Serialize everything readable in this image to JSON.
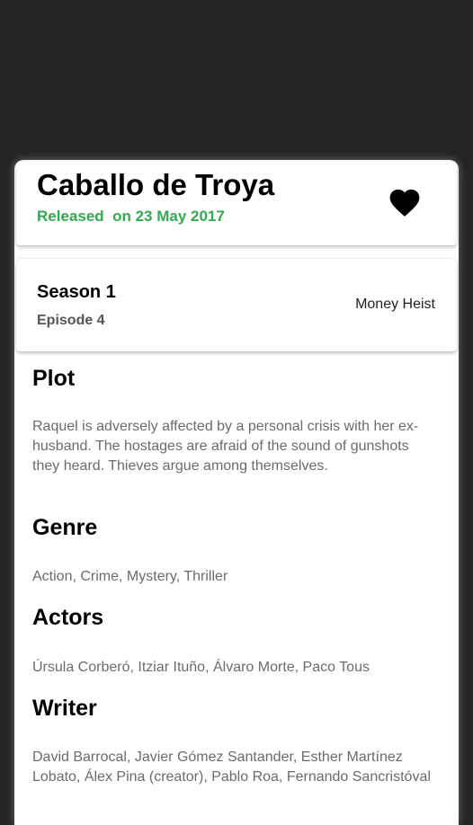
{
  "episode": {
    "title": "Caballo de Troya",
    "released": "Released  on 23 May 2017",
    "favorite_icon": "heart-icon"
  },
  "season_card": {
    "season": "Season 1",
    "episode": "Episode 4",
    "series": "Money Heist"
  },
  "sections": {
    "plot": {
      "heading": "Plot",
      "body": "Raquel is adversely affected by a personal crisis with her ex-husband. The hostages are afraid of the sound of gunshots they heard. Thieves argue among themselves."
    },
    "genre": {
      "heading": "Genre",
      "body": "Action, Crime, Mystery, Thriller"
    },
    "actors": {
      "heading": "Actors",
      "body": "Úrsula Corberó, Itziar Ituño, Álvaro Morte, Paco Tous"
    },
    "writer": {
      "heading": "Writer",
      "body": "David Barrocal, Javier Gómez Santander, Esther Martínez Lobato, Álex Pina (creator), Pablo Roa, Fernando Sancristóval"
    }
  },
  "colors": {
    "released_green": "#34a853",
    "backdrop": "#232323"
  }
}
